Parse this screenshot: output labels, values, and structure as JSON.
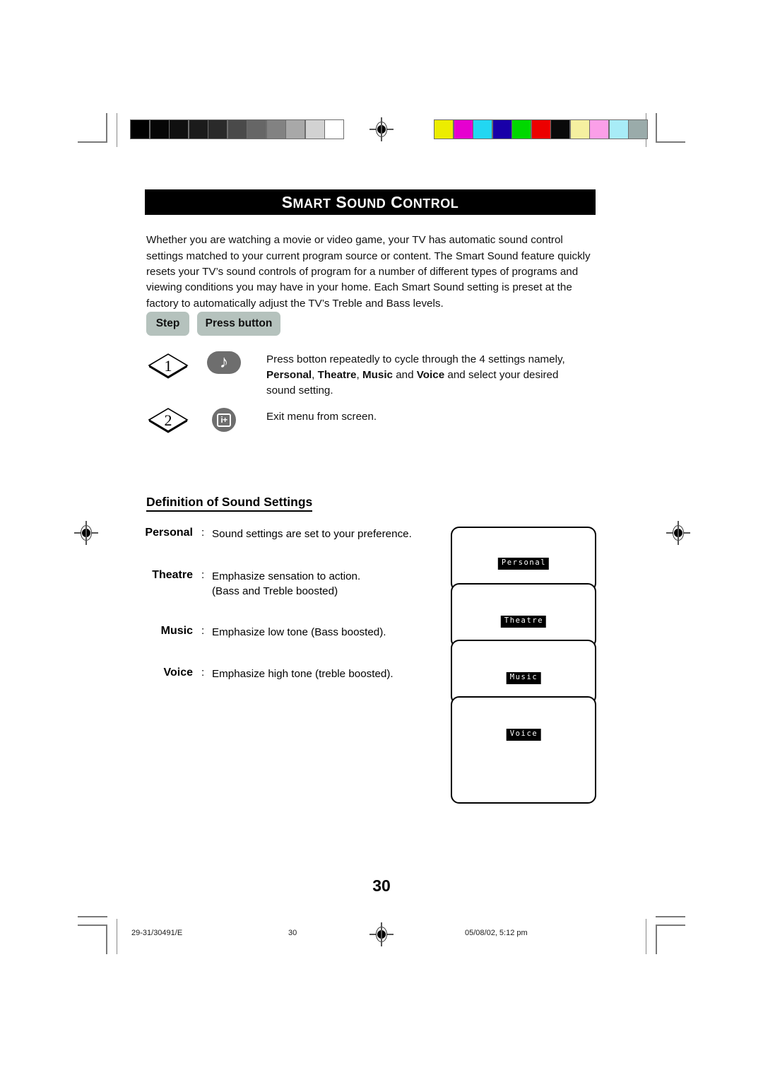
{
  "document": {
    "title": "Smart Sound Control",
    "title_parts": [
      "S",
      "MART",
      " S",
      "OUND",
      " C",
      "ONTROL"
    ],
    "intro_paragraph": "Whether you are watching a movie or video game, your TV has automatic sound control settings matched to your current program source or content. The Smart Sound feature quickly resets your TV’s sound controls of program for a number of different types of programs and viewing conditions you may have in your home. Each Smart Sound setting is preset at the factory to automatically adjust the TV’s Treble and Bass levels.",
    "page_number": "30"
  },
  "steps_table": {
    "header_step": "Step",
    "header_press_button": "Press button",
    "rows": [
      {
        "number": "1",
        "button_icon": "music-note-icon",
        "button_glyph": "♪",
        "button_shape": "pill",
        "text_line1": "Press botton repeatedly to cycle through the 4 settings namely,",
        "bold_terms": [
          "Personal",
          "Theatre",
          "Music",
          "Voice"
        ],
        "text_line2_pre": "",
        "text_line2_mid1": ", ",
        "text_line2_mid2": ", ",
        "text_line2_mid3": " and ",
        "text_line2_post": " and select your desired",
        "text_line3": "sound setting."
      },
      {
        "number": "2",
        "button_icon": "info-status-icon",
        "button_glyph": "i+",
        "button_shape": "circle",
        "text_line1": "Exit menu from screen."
      }
    ]
  },
  "definitions": {
    "heading": "Definition of Sound Settings",
    "separator": ":",
    "items": [
      {
        "term": "Personal",
        "lines": [
          "Sound settings are set to your preference."
        ]
      },
      {
        "term": "Theatre",
        "lines": [
          "Emphasize sensation to action.",
          "(Bass and Treble boosted)"
        ]
      },
      {
        "term": "Music",
        "lines": [
          "Emphasize low tone (Bass boosted)."
        ]
      },
      {
        "term": "Voice",
        "lines": [
          "Emphasize high tone (treble boosted)."
        ]
      }
    ]
  },
  "tv_screens": [
    {
      "osd_label": "Personal"
    },
    {
      "osd_label": "Theatre"
    },
    {
      "osd_label": "Music"
    },
    {
      "osd_label": "Voice"
    }
  ],
  "footer": {
    "job_code": "29-31/30491/E",
    "page": "30",
    "timestamp": "05/08/02, 5:12 pm"
  },
  "print_marks": {
    "grayscale_bar": [
      "#000000",
      "#060606",
      "#101010",
      "#1b1b1b",
      "#2a2a2a",
      "#4a4a4a",
      "#666666",
      "#828282",
      "#a8a8a8",
      "#d2d2d2",
      "#ffffff"
    ],
    "color_bar": [
      "#eced00",
      "#e600d0",
      "#22d7f2",
      "#1800a8",
      "#00d800",
      "#ec0000",
      "#0a0a0a",
      "#f5f0a0",
      "#fb9fe8",
      "#a8ecf7",
      "#9aabaa"
    ],
    "registration_icon": "registration-crosshair-icon"
  }
}
